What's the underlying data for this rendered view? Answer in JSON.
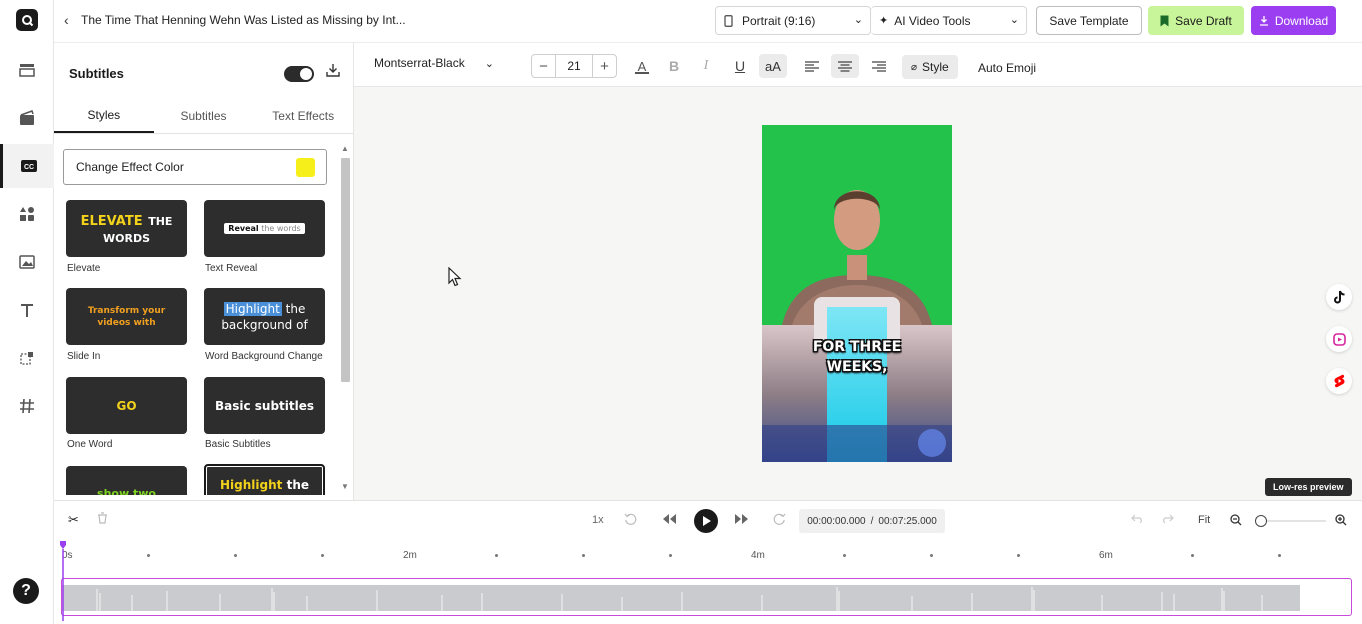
{
  "header": {
    "project_title": "The Time That Henning Wehn Was Listed as Missing by Int...",
    "aspect_ratio": "Portrait (9:16)",
    "ai_tools": "AI Video Tools",
    "save_template": "Save Template",
    "save_draft": "Save Draft",
    "download": "Download"
  },
  "sidebar": {
    "items": [
      "layout-icon",
      "media-icon",
      "subtitles-icon",
      "elements-icon",
      "images-icon",
      "text-icon",
      "transitions-icon",
      "hashtag-icon"
    ],
    "active": "subtitles-icon",
    "help": "?"
  },
  "toolbar": {
    "font": "Montserrat-Black",
    "font_size": "21",
    "style_label": "Style",
    "auto_emoji": "Auto Emoji"
  },
  "panel": {
    "title": "Subtitles",
    "tabs": [
      "Styles",
      "Subtitles",
      "Text Effects"
    ],
    "active_tab": "Styles",
    "effect_color_label": "Change Effect Color",
    "effect_color": "#f7ef1a",
    "styles": [
      {
        "name": "Elevate",
        "preview_a": "ELEVATE",
        "preview_b": "THE",
        "preview_c": "WORDS"
      },
      {
        "name": "Text Reveal",
        "preview_a": "Reveal",
        "preview_b": "the words"
      },
      {
        "name": "Slide In",
        "preview_a": "Transform your",
        "preview_b": "videos with"
      },
      {
        "name": "Word Background Change",
        "preview_a": "Highlight",
        "preview_b": "the",
        "preview_c": "background of"
      },
      {
        "name": "One Word",
        "preview_a": "GO"
      },
      {
        "name": "Basic Subtitles",
        "preview_a": "Basic subtitles"
      },
      {
        "name": "",
        "preview_a": "show two"
      },
      {
        "name": "",
        "preview_a": "Highlight",
        "preview_b": "the"
      }
    ]
  },
  "preview": {
    "caption": "FOR THREE WEEKS,",
    "low_res": "Low-res preview"
  },
  "timeline": {
    "speed": "1x",
    "current_time": "00:00:00.000",
    "separator": "/",
    "total_time": "00:07:25.000",
    "fit": "Fit",
    "ruler": [
      "0s",
      "2m",
      "4m",
      "6m"
    ]
  }
}
